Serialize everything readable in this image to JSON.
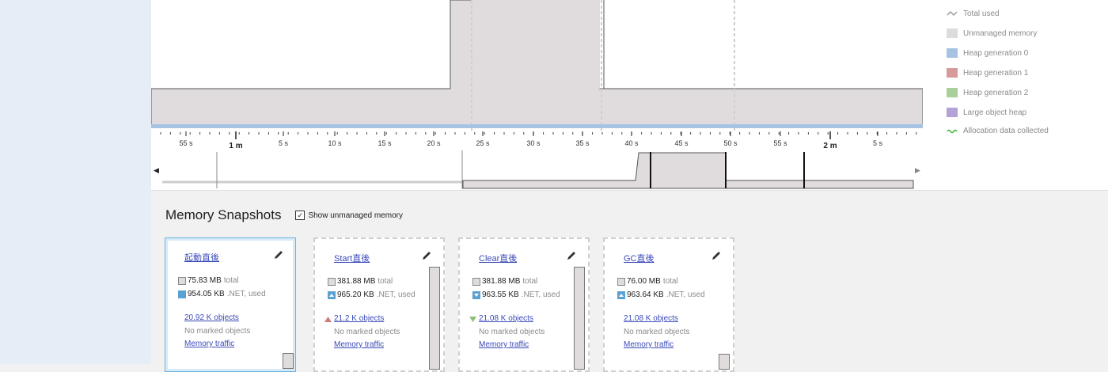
{
  "legend": {
    "items": [
      {
        "label": "Total used",
        "color": "#9a9a9a",
        "icon": "line-swatch-icon"
      },
      {
        "label": "Unmanaged memory",
        "color": "#dcdcdc",
        "icon": "area-swatch-icon"
      },
      {
        "label": "Heap generation 0",
        "color": "#a7c3e3",
        "icon": "area-swatch-icon"
      },
      {
        "label": "Heap generation 1",
        "color": "#d79a9a",
        "icon": "area-swatch-icon"
      },
      {
        "label": "Heap generation 2",
        "color": "#a9cf9a",
        "icon": "area-swatch-icon"
      },
      {
        "label": "Large object heap",
        "color": "#b3a2d8",
        "icon": "area-swatch-icon"
      },
      {
        "label": "Allocation data collected",
        "color": "#3ab53a",
        "icon": "wave-swatch-icon"
      }
    ]
  },
  "timeline": {
    "ticks": [
      "55 s",
      "1 m",
      "5 s",
      "10 s",
      "15 s",
      "20 s",
      "25 s",
      "30 s",
      "35 s",
      "40 s",
      "45 s",
      "50 s",
      "55 s",
      "2 m",
      "5 s"
    ],
    "major_ticks": [
      "1 m",
      "2 m"
    ]
  },
  "snapshots": {
    "title": "Memory Snapshots",
    "show_unmanaged_label": "Show unmanaged memory",
    "show_unmanaged_checked": true,
    "cards": [
      {
        "name": "起動直後",
        "total": "75.83 MB",
        "total_suffix": "total",
        "net": "954.05 KB",
        "net_suffix": ".NET, used",
        "objects": "20.92 K objects",
        "objects_trend": "none",
        "marked": "No marked objects",
        "traffic": "Memory traffic",
        "selected": true
      },
      {
        "name": "Start直後",
        "total": "381.88 MB",
        "total_suffix": "total",
        "net": "965.20 KB",
        "net_suffix": ".NET, used",
        "objects": "21.2 K objects",
        "objects_trend": "up",
        "marked": "No marked objects",
        "traffic": "Memory traffic",
        "selected": false
      },
      {
        "name": "Clear直後",
        "total": "381.88 MB",
        "total_suffix": "total",
        "net": "963.55 KB",
        "net_suffix": ".NET, used",
        "objects": "21.08 K objects",
        "objects_trend": "down",
        "marked": "No marked objects",
        "traffic": "Memory traffic",
        "selected": false
      },
      {
        "name": "GC直後",
        "total": "76.00 MB",
        "total_suffix": "total",
        "net": "963.64 KB",
        "net_suffix": ".NET, used",
        "objects": "21.08 K objects",
        "objects_trend": "none",
        "marked": "No marked objects",
        "traffic": "Memory traffic",
        "selected": false
      }
    ]
  }
}
